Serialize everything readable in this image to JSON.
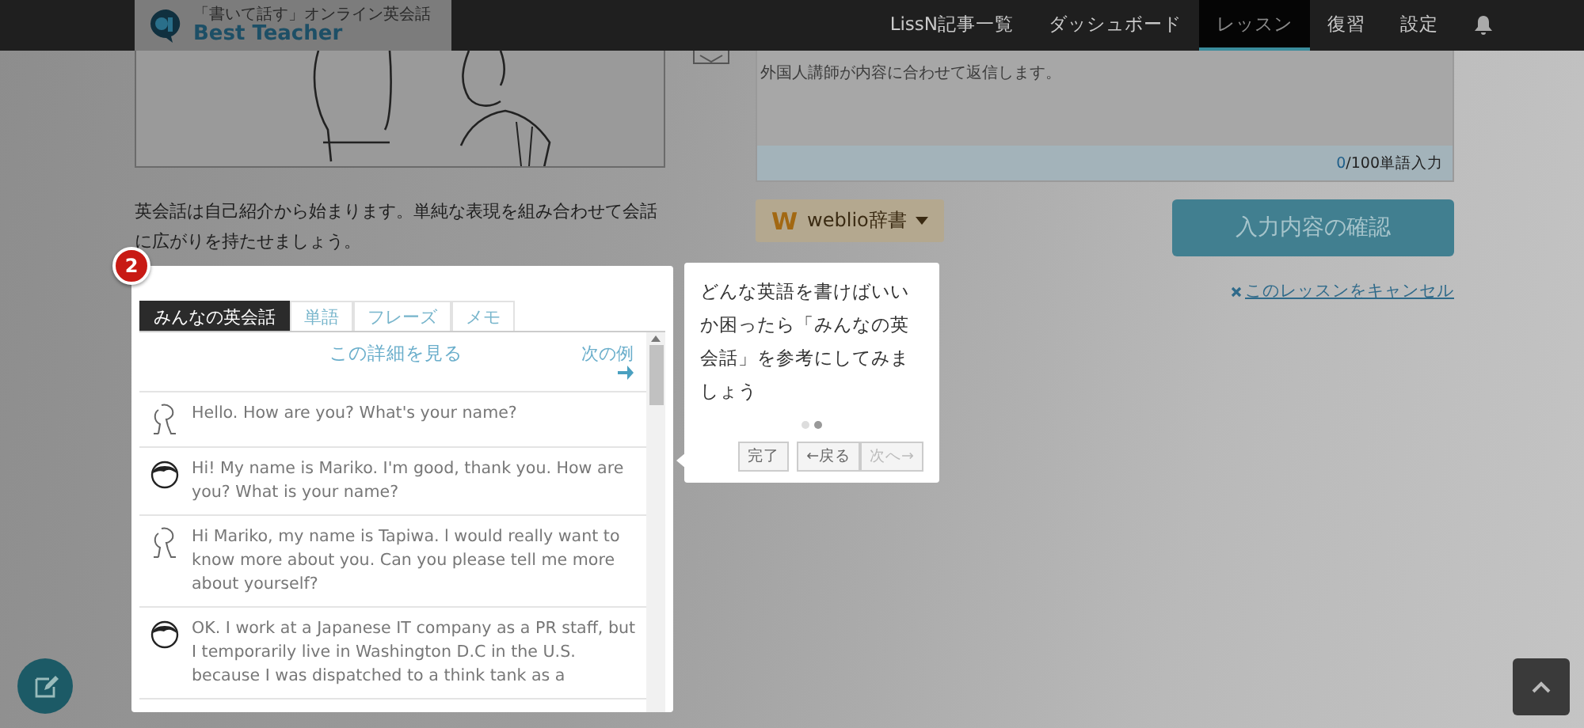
{
  "header": {
    "logo": {
      "tagline": "「書いて話す」オンライン英会話",
      "name": "Best Teacher"
    },
    "nav": [
      {
        "label": "LissN記事一覧",
        "selected": false
      },
      {
        "label": "ダッシュボード",
        "selected": false
      },
      {
        "label": "レッスン",
        "selected": true
      },
      {
        "label": "復習",
        "selected": false
      },
      {
        "label": "設定",
        "selected": false
      }
    ]
  },
  "lesson": {
    "intro": "英会話は自己紹介から始まります。単純な表現を組み合わせて会話に広がりを持たせましょう。"
  },
  "editor": {
    "hint": "外国人講師が内容に合わせて返信します。",
    "count": "0",
    "count_suffix": "/100単語入力",
    "dictionary": {
      "mark": "W",
      "label": "weblio辞書"
    },
    "confirm": "入力内容の確認",
    "cancel": "このレッスンをキャンセル"
  },
  "tour": {
    "step": "2",
    "text": "どんな英語を書けばいいか困ったら「みんなの英会話」を参考にしてみましょう",
    "dots": [
      {
        "selected": false
      },
      {
        "selected": true
      }
    ],
    "buttons": [
      {
        "label": "完了",
        "disabled": false
      },
      {
        "label": "←戻る",
        "disabled": false
      },
      {
        "label": "次へ→",
        "disabled": true
      }
    ]
  },
  "panel": {
    "tabs": [
      {
        "label": "みんなの英会話",
        "selected": true
      },
      {
        "label": "単語",
        "selected": false
      },
      {
        "label": "フレーズ",
        "selected": false
      },
      {
        "label": "メモ",
        "selected": false
      }
    ],
    "detail_link": "この詳細を見る",
    "next_link": "次の例",
    "messages": [
      {
        "kind": "sketch",
        "text": "Hello. How are you? What's your name?"
      },
      {
        "kind": "person",
        "text": "Hi! My name is Mariko. I'm good, thank you. How are you? What is your name?"
      },
      {
        "kind": "sketch",
        "text": "Hi Mariko, my name is Tapiwa. l would really want to know more about you. Can you please tell me more about yourself?"
      },
      {
        "kind": "person",
        "text": "OK. I work at a Japanese IT company as a PR staff, but I temporarily live in Washington D.C in the U.S. because I was dispatched to a think tank as a"
      }
    ]
  }
}
